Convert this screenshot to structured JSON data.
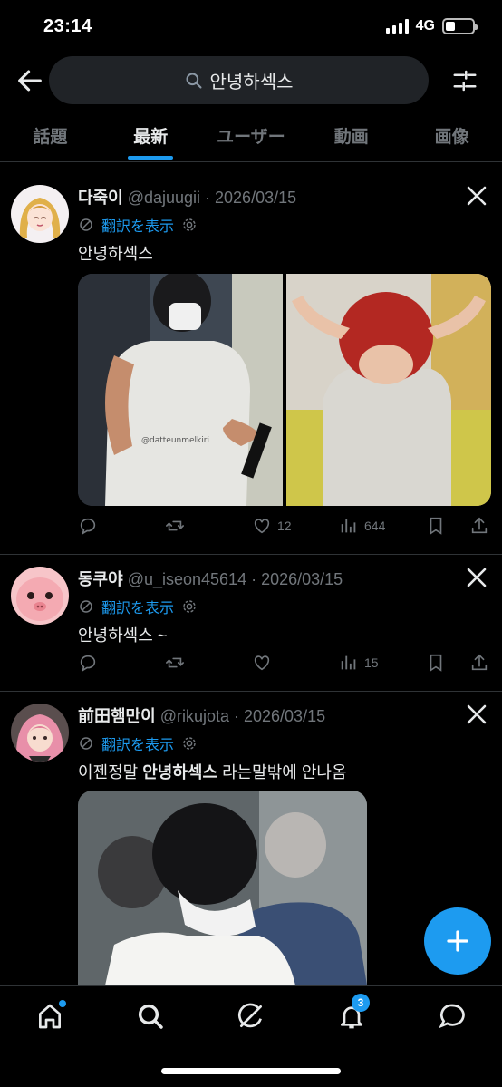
{
  "status": {
    "time": "23:14",
    "network": "4G",
    "battery_level": 0.35
  },
  "search": {
    "query": "안녕하섹스"
  },
  "tabs": [
    {
      "label": "話題",
      "active": false
    },
    {
      "label": "最新",
      "active": true
    },
    {
      "label": "ユーザー",
      "active": false
    },
    {
      "label": "動画",
      "active": false
    },
    {
      "label": "画像",
      "active": false
    }
  ],
  "tweets": [
    {
      "name": "다죽이",
      "meta": "@dajuugii · 2026/03/15",
      "translate": "翻訳を表示",
      "text": "안녕하섹스",
      "media_watermark": "@datteunmelkiri",
      "stats": {
        "likes": "12",
        "views": "644"
      }
    },
    {
      "name": "동쿠야",
      "meta": "@u_iseon45614 · 2026/03/15",
      "translate": "翻訳を表示",
      "text": "안녕하섹스 ~",
      "stats": {
        "views": "15"
      }
    },
    {
      "name": "前田햄만이",
      "meta": "@rikujota · 2026/03/15",
      "translate": "翻訳を表示",
      "text_before": "이젠정말 ",
      "text_bold": "안녕하섹스",
      "text_after": " 라는말밖에 안나옴"
    }
  ],
  "notifications_badge": "3",
  "colors": {
    "accent": "#1d9bf0",
    "background": "#000000",
    "muted": "#71767b"
  }
}
